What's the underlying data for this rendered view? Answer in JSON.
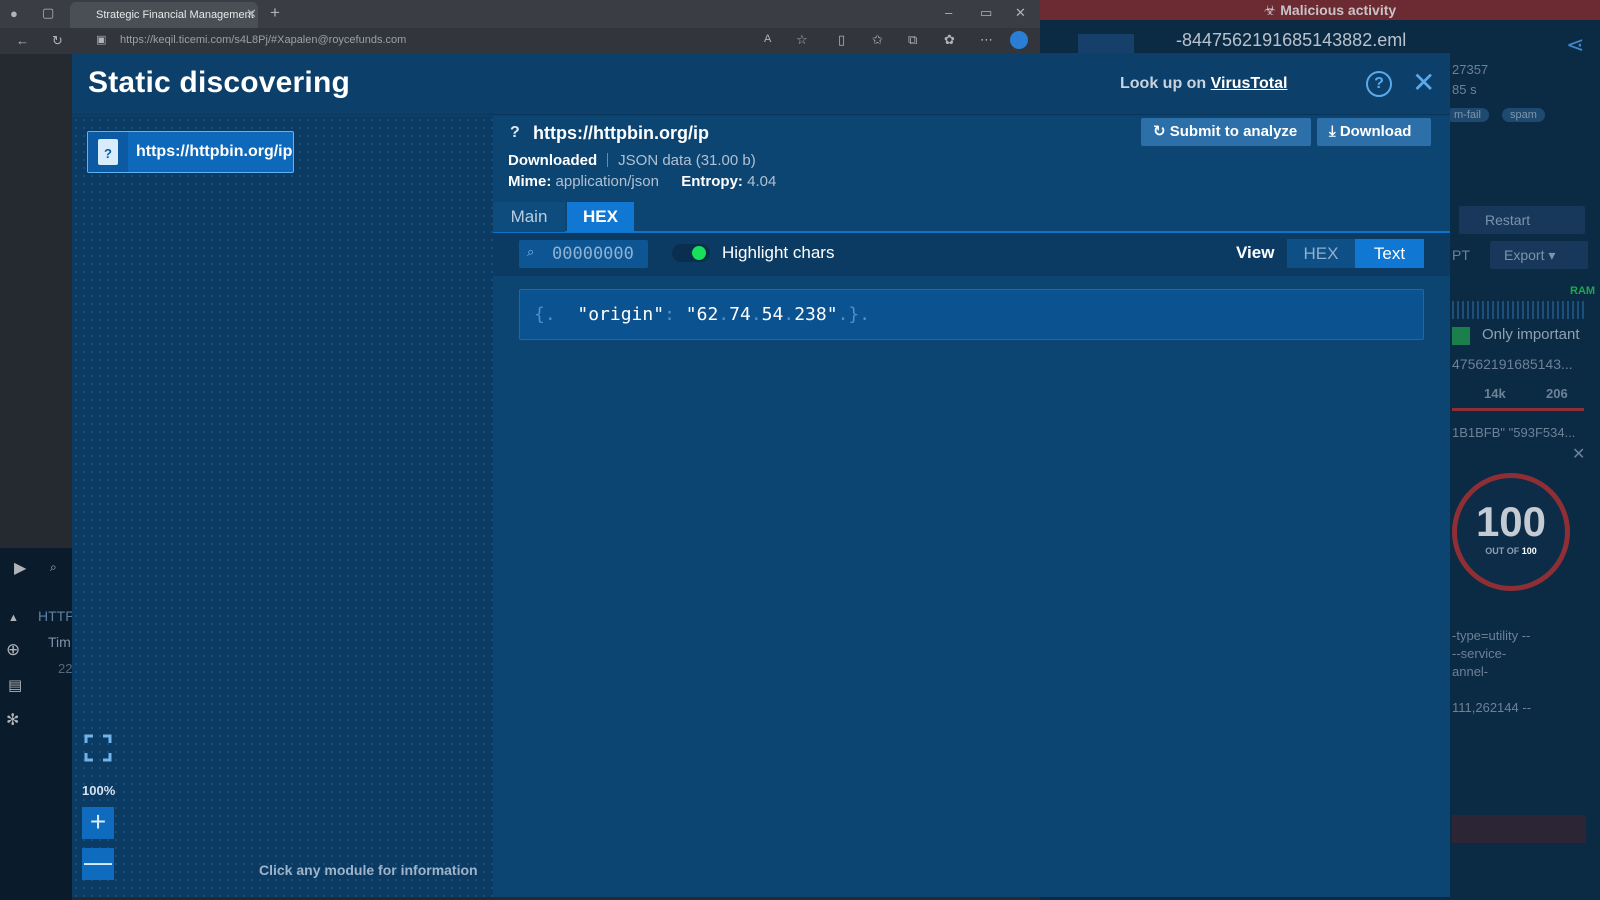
{
  "browser": {
    "tab_title": "Strategic Financial Management",
    "url": "https://keqil.ticemi.com/s4L8Pj/#Xapalen@roycefunds.com"
  },
  "report": {
    "banner": "Malicious activity",
    "filename": "-8447562191685143882.eml",
    "fragment_1": "27357",
    "fragment_2": "85 s",
    "tags": [
      "m-fail",
      "spam"
    ],
    "restart_label": "Restart",
    "pt_label": "PT",
    "export_label": "Export",
    "ram_label": "RAM",
    "only_important": "Only important",
    "process_name": "47562191685143...",
    "stat_1": "14k",
    "stat_2": "206",
    "hash_fragment": "1B1BFB\" \"593F534...",
    "score": "100",
    "score_out_of": "OUT OF",
    "score_max": "100",
    "cmd_1": "-type=utility --",
    "cmd_2": "--service-",
    "cmd_3": "annel-",
    "cmd_4": "111,262144 --"
  },
  "background": {
    "http_label": "HTTP",
    "time_label": "Tim",
    "row_value": "22"
  },
  "dialog": {
    "title": "Static discovering",
    "lookup_prefix": "Look up on ",
    "lookup_link": "VirusTotal",
    "help_symbol": "?",
    "close_symbol": "✕"
  },
  "canvas": {
    "node_label": "https://httpbin.org/ip",
    "node_icon_symbol": "?",
    "zoom_level": "100%",
    "zoom_in_symbol": "+",
    "zoom_out_symbol": "—",
    "hint": "Click any module for information"
  },
  "detail": {
    "unknown_symbol": "?",
    "url": "https://httpbin.org/ip",
    "submit_label": "Submit to analyze",
    "download_label": "Download",
    "status": "Downloaded",
    "filetype": "JSON data (31.00 b)",
    "mime_label": "Mime:",
    "mime_value": "application/json",
    "entropy_label": "Entropy:",
    "entropy_value": "4.04",
    "tabs": [
      "Main",
      "HEX"
    ],
    "active_tab": "HEX",
    "offset": "00000000",
    "highlight_label": "Highlight chars",
    "highlight_enabled": true,
    "view_label": "View",
    "view_options": [
      "HEX",
      "Text"
    ],
    "active_view": "Text",
    "content": {
      "open_brace": "{",
      "key": "\"origin\"",
      "colon": ":",
      "value_q1": "\"",
      "ip_parts": [
        "62",
        "74",
        "54",
        "238"
      ],
      "value_q2": "\"",
      "close_brace": "}",
      "dot": "."
    }
  },
  "colors": {
    "accent": "#1078d2",
    "dialog_bg": "#0d416d",
    "malicious": "#8e2f36",
    "toggle_on": "#18e05a"
  },
  "icons": [
    "search-icon",
    "help-icon",
    "close-icon",
    "refresh-icon",
    "download-icon",
    "fullscreen-icon",
    "document-icon",
    "globe-icon",
    "bug-icon",
    "share-icon",
    "biohazard-icon"
  ]
}
